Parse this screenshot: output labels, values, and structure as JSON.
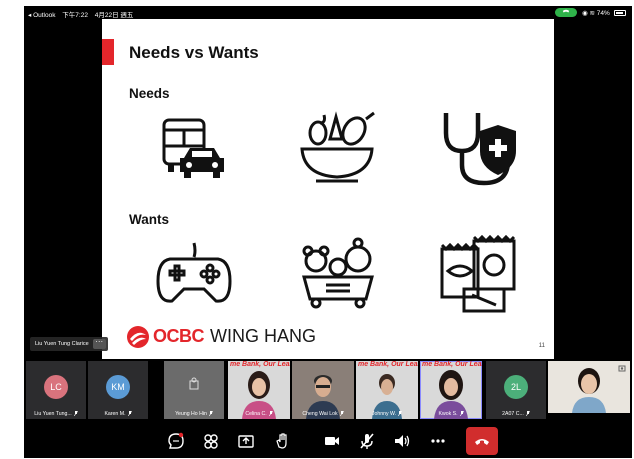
{
  "status_bar": {
    "back_app": "◂ Outlook",
    "time": "下午7:22",
    "date": "4月22日 週五",
    "battery": "74%"
  },
  "slide": {
    "title": "Needs vs Wants",
    "section_needs": "Needs",
    "section_wants": "Wants",
    "brand_red": "OCBC",
    "brand_dark": "WING HANG",
    "page_number": "11",
    "need_icons": [
      "transport-icon",
      "food-bowl-icon",
      "health-insurance-icon"
    ],
    "want_icons": [
      "game-controller-icon",
      "toys-icon",
      "snacks-icon"
    ]
  },
  "name_tag": {
    "name": "Liu Yuen Tung Clarice",
    "more": "···"
  },
  "participants": [
    {
      "name": "Liu Yuen Tung...",
      "initials": "LC",
      "color": "#d9737d"
    },
    {
      "name": "Karen M.",
      "initials": "KM",
      "color": "#5b9bd5"
    },
    {
      "name": "Yeung Ho Hin",
      "initials": "",
      "color": "#6b6b6b"
    },
    {
      "name": "Celina C.",
      "initials": "",
      "color": ""
    },
    {
      "name": "Cheng Wai Lok",
      "initials": "",
      "color": ""
    },
    {
      "name": "Johnny W.",
      "initials": "",
      "color": ""
    },
    {
      "name": "Kwok S.",
      "initials": "",
      "color": ""
    },
    {
      "name": "2A07 C...",
      "initials": "2L",
      "color": "#4caf7a"
    },
    {
      "name": "",
      "initials": "",
      "color": ""
    }
  ],
  "video_banner": "me Bank, Our Learn",
  "toolbar": [
    "chat-icon",
    "participants-icon",
    "share-icon",
    "raise-hand-icon",
    "camera-icon",
    "mic-muted-icon",
    "speaker-icon",
    "more-icon"
  ],
  "colors": {
    "accent": "#e3262b",
    "leave": "#d12d2d",
    "active_outline": "#8a8aff"
  }
}
